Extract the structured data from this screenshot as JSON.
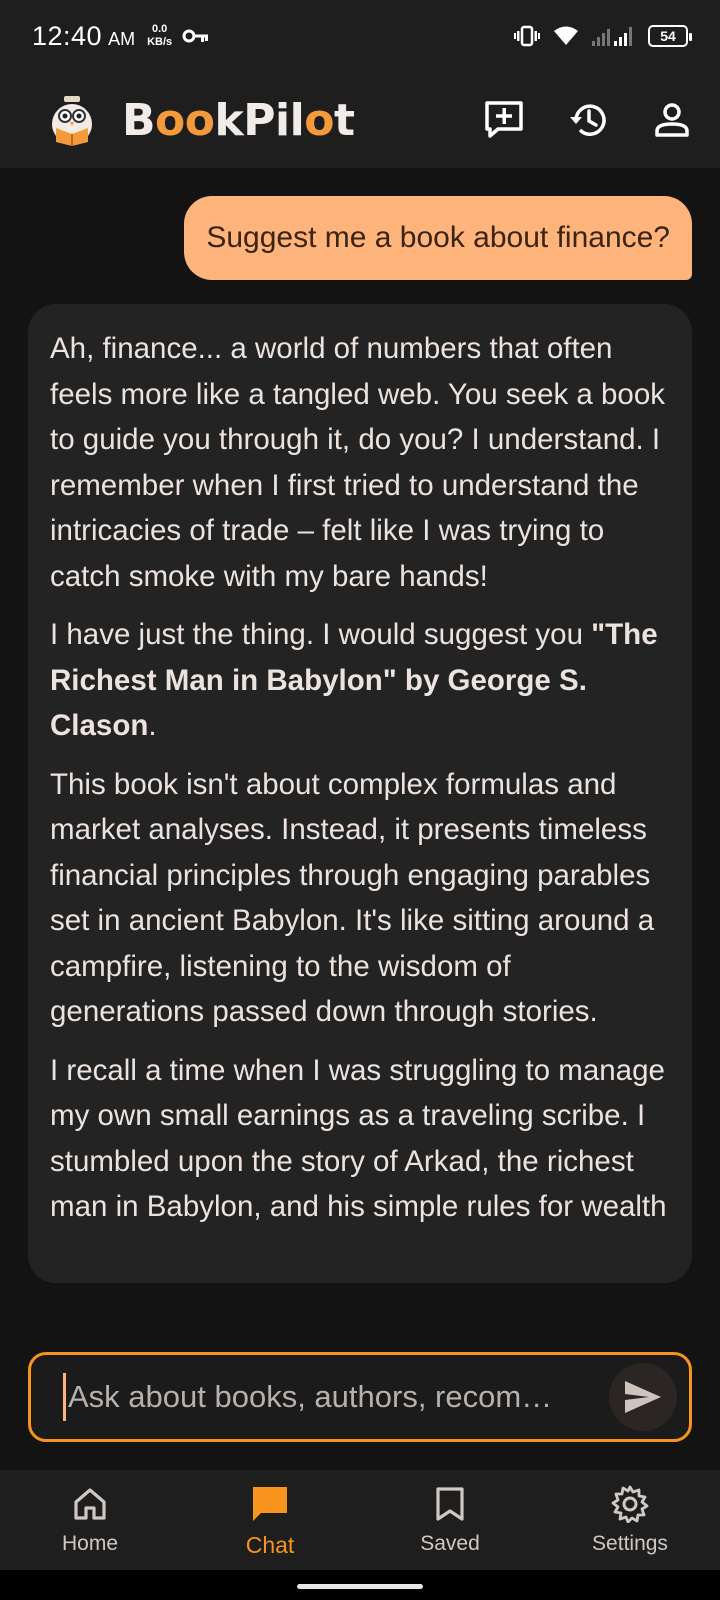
{
  "status_bar": {
    "time": "12:40",
    "ampm": "AM",
    "speed_value": "0.0",
    "speed_unit": "KB/s",
    "battery": "54"
  },
  "app_bar": {
    "logo_text_pre": "B",
    "logo_text_oo": "oo",
    "logo_text_post": "kPil",
    "logo_text_o": "o",
    "logo_text_end": "t"
  },
  "chat": {
    "user_message": "Suggest me a book about finance?",
    "bot_paragraphs": {
      "p1": "Ah, finance... a world of numbers that often feels more like a tangled web. You seek a book to guide you through it, do you? I understand. I remember when I first tried to understand the intricacies of trade – felt like I was trying to catch smoke with my bare hands!",
      "p2_pre": "I have just the thing. I would suggest you ",
      "p2_bold": "\"The Richest Man in Babylon\" by George S. Clason",
      "p2_post": ".",
      "p3": "This book isn't about complex formulas and market analyses. Instead, it presents timeless financial principles through engaging parables set in ancient Babylon. It's like sitting around a campfire, listening to the wisdom of generations passed down through stories.",
      "p4": "I recall a time when I was struggling to manage my own small earnings as a traveling scribe. I stumbled upon the story of Arkad, the richest man in Babylon, and his simple rules for wealth"
    }
  },
  "input": {
    "placeholder": "Ask about books, authors, recom…"
  },
  "nav": {
    "items": [
      {
        "label": "Home"
      },
      {
        "label": "Chat"
      },
      {
        "label": "Saved"
      },
      {
        "label": "Settings"
      }
    ]
  },
  "colors": {
    "accent": "#f7941d",
    "user_bubble": "#ffb47c",
    "bot_bubble": "#232323",
    "background": "#131313"
  }
}
